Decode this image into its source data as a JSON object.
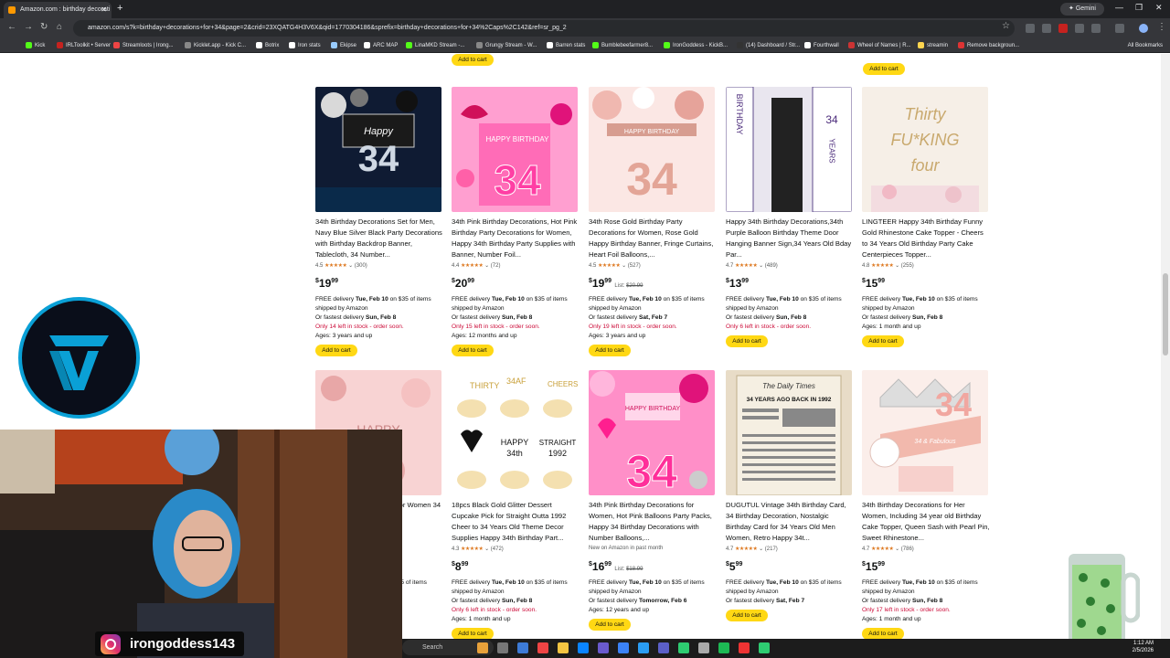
{
  "browser": {
    "tab_title": "Amazon.com : birthday decorati",
    "gemini_label": "Gemini",
    "url": "amazon.com/s?k=birthday+decorations+for+34&page=2&crid=23XQATG4H3V6X&qid=1770304186&sprefix=birthday+decorations+for+34%2Caps%2C142&ref=sr_pg_2",
    "bookmarks": [
      "Kick",
      "IRLToolkit • Server",
      "Streamloots | Irong...",
      "Kicklet.app - Kick C...",
      "Botrix",
      "Iron stats",
      "Ekipse",
      "ARC MAP",
      "LinaMKD Stream -...",
      "Grungy Stream - W...",
      "Barren stats",
      "Bumblebeefarmer8...",
      "IronGoddess - KickB...",
      "(14) Dashboard / Str...",
      "Fourthwall",
      "Wheel of Names | R...",
      "streamin",
      "Remove backgroun..."
    ],
    "all_bookmarks": "All Bookmarks"
  },
  "page": {
    "top_add_to_cart": "Add to cart",
    "products": [
      {
        "title": "34th Birthday Decorations Set for Men, Navy Blue Silver Black Party Decorations with Birthday Backdrop Banner, Tablecloth, 34 Number...",
        "rating": "4.5",
        "reviews": "(300)",
        "price_whole": "19",
        "price_frac": "99",
        "list_price": "",
        "delivery": "FREE delivery",
        "delivery_date": "Tue, Feb 10",
        "delivery_rest": "on $35 of items shipped by Amazon",
        "fastest": "Or fastest delivery",
        "fastest_date": "Sun, Feb 8",
        "stock": "Only 14 left in stock - order soon.",
        "ages": "Ages: 3 years and up",
        "cart": "Add to cart",
        "theme": "navy"
      },
      {
        "title": "34th Pink Birthday Decorations, Hot Pink Birthday Party Decorations for Women, Happy 34th Birthday Party Supplies with Banner, Number Foil...",
        "rating": "4.4",
        "reviews": "(72)",
        "price_whole": "20",
        "price_frac": "99",
        "list_price": "",
        "delivery": "FREE delivery",
        "delivery_date": "Tue, Feb 10",
        "delivery_rest": "on $35 of items shipped by Amazon",
        "fastest": "Or fastest delivery",
        "fastest_date": "Sun, Feb 8",
        "stock": "Only 15 left in stock - order soon.",
        "ages": "Ages: 12 months and up",
        "cart": "Add to cart",
        "theme": "hotpink"
      },
      {
        "title": "34th Rose Gold Birthday Party Decorations for Women, Rose Gold Happy Birthday Banner, Fringe Curtains, Heart Foil Balloons,...",
        "rating": "4.5",
        "reviews": "(527)",
        "price_whole": "19",
        "price_frac": "99",
        "list_price": "$20.99",
        "delivery": "FREE delivery",
        "delivery_date": "Tue, Feb 10",
        "delivery_rest": "on $35 of items shipped by Amazon",
        "fastest": "Or fastest delivery",
        "fastest_date": "Sat, Feb 7",
        "stock": "Only 19 left in stock - order soon.",
        "ages": "Ages: 3 years and up",
        "cart": "Add to cart",
        "theme": "rosegold"
      },
      {
        "title": "Happy 34th Birthday Decorations,34th Purple Balloon Birthday Theme Door Hanging Banner Sign,34 Years Old Bday Par...",
        "rating": "4.7",
        "reviews": "(489)",
        "price_whole": "13",
        "price_frac": "99",
        "list_price": "",
        "delivery": "FREE delivery",
        "delivery_date": "Tue, Feb 10",
        "delivery_rest": "on $35 of items shipped by Amazon",
        "fastest": "Or fastest delivery",
        "fastest_date": "Sun, Feb 8",
        "stock": "Only 6 left in stock - order soon.",
        "ages": "",
        "cart": "Add to cart",
        "theme": "purple"
      },
      {
        "title": "LINGTEER Happy 34th Birthday Funny Gold Rhinestone Cake Topper - Cheers to 34 Years Old Birthday Party Cake Centerpieces Topper...",
        "rating": "4.8",
        "reviews": "(255)",
        "price_whole": "15",
        "price_frac": "99",
        "list_price": "",
        "delivery": "FREE delivery",
        "delivery_date": "Tue, Feb 10",
        "delivery_rest": "on $35 of items shipped by Amazon",
        "fastest": "Or fastest delivery",
        "fastest_date": "Sun, Feb 8",
        "stock": "",
        "ages": "Ages: 1 month and up",
        "cart": "Add to cart",
        "theme": "cake"
      },
      {
        "title": "34th Birthday Decorations for Women 34 Includes ...oil Balloo...",
        "rating": "",
        "reviews": "",
        "price_whole": "",
        "price_frac": "",
        "list_price": "",
        "delivery": "",
        "delivery_date": "",
        "delivery_rest": "$35 of items",
        "fastest": "",
        "fastest_date": "",
        "stock": "",
        "ages": "",
        "cart": "",
        "theme": "rosegold2"
      },
      {
        "title": "18pcs Black Gold Glitter Dessert Cupcake Pick for Straight Outta 1992 Cheer to 34 Years Old Theme Decor Supplies Happy 34th Birthday Part...",
        "rating": "4.3",
        "reviews": "(472)",
        "price_whole": "8",
        "price_frac": "99",
        "list_price": "",
        "delivery": "FREE delivery",
        "delivery_date": "Tue, Feb 10",
        "delivery_rest": "on $35 of items shipped by Amazon",
        "fastest": "Or fastest delivery",
        "fastest_date": "Sun, Feb 8",
        "stock": "Only 6 left in stock - order soon.",
        "ages": "Ages: 1 month and up",
        "cart": "Add to cart",
        "theme": "cupcake"
      },
      {
        "title": "34th Pink Birthday Decorations for Women, Hot Pink Balloons Party Packs, Happy 34 Birthday Decorations with Number Balloons,...",
        "rating": "",
        "reviews": "",
        "new_on": "New on Amazon in past month",
        "price_whole": "16",
        "price_frac": "99",
        "list_price": "$18.99",
        "delivery": "FREE delivery",
        "delivery_date": "Tue, Feb 10",
        "delivery_rest": "on $35 of items shipped by Amazon",
        "fastest": "Or fastest delivery",
        "fastest_date": "Tomorrow, Feb 6",
        "stock": "",
        "ages": "Ages: 12 years and up",
        "cart": "Add to cart",
        "theme": "hotpink2"
      },
      {
        "title": "DUGUTUL Vintage 34th Birthday Card, 34 Birthday Decoration, Nostalgic Birthday Card for 34 Years Old Men Women, Retro Happy 34t...",
        "rating": "4.7",
        "reviews": "(217)",
        "price_whole": "5",
        "price_frac": "99",
        "list_price": "",
        "delivery": "FREE delivery",
        "delivery_date": "Tue, Feb 10",
        "delivery_rest": "on $35 of items shipped by Amazon",
        "fastest": "Or fastest delivery",
        "fastest_date": "Sat, Feb 7",
        "stock": "",
        "ages": "",
        "cart": "Add to cart",
        "theme": "card",
        "card_heading": "The Daily Times",
        "card_headline": "34 YEARS AGO BACK IN 1992"
      },
      {
        "title": "34th Birthday Decorations for Her Women, Including 34 year old Birthday Cake Topper, Queen Sash with Pearl Pin, Sweet Rhinestone...",
        "rating": "4.7",
        "reviews": "(786)",
        "price_whole": "15",
        "price_frac": "99",
        "list_price": "",
        "delivery": "FREE delivery",
        "delivery_date": "Tue, Feb 10",
        "delivery_rest": "on $35 of items shipped by Amazon",
        "fastest": "Or fastest delivery",
        "fastest_date": "Sun, Feb 8",
        "stock": "Only 17 left in stock - order soon.",
        "ages": "Ages: 1 month and up",
        "cart": "Add to cart",
        "theme": "sash"
      }
    ]
  },
  "overlay": {
    "handle": "irongoddess143"
  },
  "taskbar": {
    "search_placeholder": "Search",
    "time": "1:12 AM",
    "date": "2/5/2026"
  },
  "colors": {
    "accent_yellow": "#ffd814",
    "star_orange": "#de7921",
    "stock_red": "#cc0c39"
  }
}
